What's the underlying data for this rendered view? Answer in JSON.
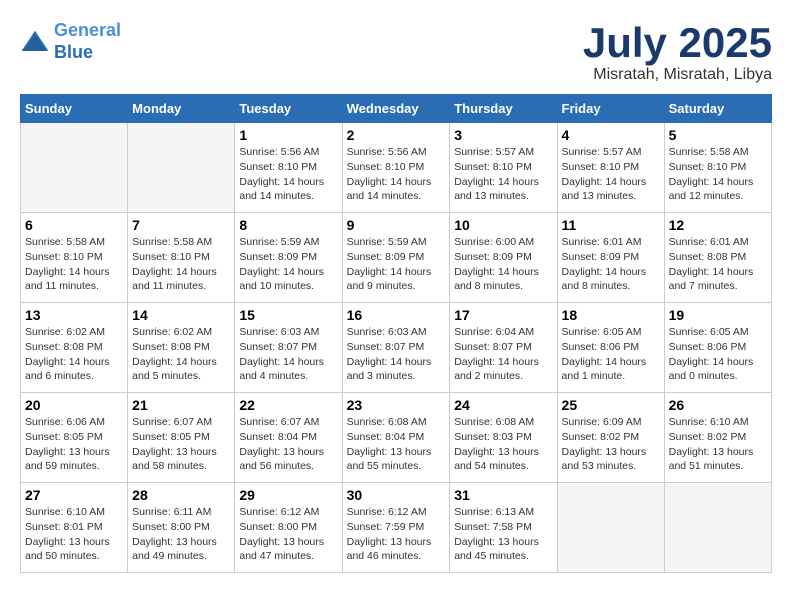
{
  "header": {
    "logo_line1": "General",
    "logo_line2": "Blue",
    "month_title": "July 2025",
    "location": "Misratah, Misratah, Libya"
  },
  "weekdays": [
    "Sunday",
    "Monday",
    "Tuesday",
    "Wednesday",
    "Thursday",
    "Friday",
    "Saturday"
  ],
  "weeks": [
    [
      {
        "day": "",
        "info": ""
      },
      {
        "day": "",
        "info": ""
      },
      {
        "day": "1",
        "info": "Sunrise: 5:56 AM\nSunset: 8:10 PM\nDaylight: 14 hours and 14 minutes."
      },
      {
        "day": "2",
        "info": "Sunrise: 5:56 AM\nSunset: 8:10 PM\nDaylight: 14 hours and 14 minutes."
      },
      {
        "day": "3",
        "info": "Sunrise: 5:57 AM\nSunset: 8:10 PM\nDaylight: 14 hours and 13 minutes."
      },
      {
        "day": "4",
        "info": "Sunrise: 5:57 AM\nSunset: 8:10 PM\nDaylight: 14 hours and 13 minutes."
      },
      {
        "day": "5",
        "info": "Sunrise: 5:58 AM\nSunset: 8:10 PM\nDaylight: 14 hours and 12 minutes."
      }
    ],
    [
      {
        "day": "6",
        "info": "Sunrise: 5:58 AM\nSunset: 8:10 PM\nDaylight: 14 hours and 11 minutes."
      },
      {
        "day": "7",
        "info": "Sunrise: 5:58 AM\nSunset: 8:10 PM\nDaylight: 14 hours and 11 minutes."
      },
      {
        "day": "8",
        "info": "Sunrise: 5:59 AM\nSunset: 8:09 PM\nDaylight: 14 hours and 10 minutes."
      },
      {
        "day": "9",
        "info": "Sunrise: 5:59 AM\nSunset: 8:09 PM\nDaylight: 14 hours and 9 minutes."
      },
      {
        "day": "10",
        "info": "Sunrise: 6:00 AM\nSunset: 8:09 PM\nDaylight: 14 hours and 8 minutes."
      },
      {
        "day": "11",
        "info": "Sunrise: 6:01 AM\nSunset: 8:09 PM\nDaylight: 14 hours and 8 minutes."
      },
      {
        "day": "12",
        "info": "Sunrise: 6:01 AM\nSunset: 8:08 PM\nDaylight: 14 hours and 7 minutes."
      }
    ],
    [
      {
        "day": "13",
        "info": "Sunrise: 6:02 AM\nSunset: 8:08 PM\nDaylight: 14 hours and 6 minutes."
      },
      {
        "day": "14",
        "info": "Sunrise: 6:02 AM\nSunset: 8:08 PM\nDaylight: 14 hours and 5 minutes."
      },
      {
        "day": "15",
        "info": "Sunrise: 6:03 AM\nSunset: 8:07 PM\nDaylight: 14 hours and 4 minutes."
      },
      {
        "day": "16",
        "info": "Sunrise: 6:03 AM\nSunset: 8:07 PM\nDaylight: 14 hours and 3 minutes."
      },
      {
        "day": "17",
        "info": "Sunrise: 6:04 AM\nSunset: 8:07 PM\nDaylight: 14 hours and 2 minutes."
      },
      {
        "day": "18",
        "info": "Sunrise: 6:05 AM\nSunset: 8:06 PM\nDaylight: 14 hours and 1 minute."
      },
      {
        "day": "19",
        "info": "Sunrise: 6:05 AM\nSunset: 8:06 PM\nDaylight: 14 hours and 0 minutes."
      }
    ],
    [
      {
        "day": "20",
        "info": "Sunrise: 6:06 AM\nSunset: 8:05 PM\nDaylight: 13 hours and 59 minutes."
      },
      {
        "day": "21",
        "info": "Sunrise: 6:07 AM\nSunset: 8:05 PM\nDaylight: 13 hours and 58 minutes."
      },
      {
        "day": "22",
        "info": "Sunrise: 6:07 AM\nSunset: 8:04 PM\nDaylight: 13 hours and 56 minutes."
      },
      {
        "day": "23",
        "info": "Sunrise: 6:08 AM\nSunset: 8:04 PM\nDaylight: 13 hours and 55 minutes."
      },
      {
        "day": "24",
        "info": "Sunrise: 6:08 AM\nSunset: 8:03 PM\nDaylight: 13 hours and 54 minutes."
      },
      {
        "day": "25",
        "info": "Sunrise: 6:09 AM\nSunset: 8:02 PM\nDaylight: 13 hours and 53 minutes."
      },
      {
        "day": "26",
        "info": "Sunrise: 6:10 AM\nSunset: 8:02 PM\nDaylight: 13 hours and 51 minutes."
      }
    ],
    [
      {
        "day": "27",
        "info": "Sunrise: 6:10 AM\nSunset: 8:01 PM\nDaylight: 13 hours and 50 minutes."
      },
      {
        "day": "28",
        "info": "Sunrise: 6:11 AM\nSunset: 8:00 PM\nDaylight: 13 hours and 49 minutes."
      },
      {
        "day": "29",
        "info": "Sunrise: 6:12 AM\nSunset: 8:00 PM\nDaylight: 13 hours and 47 minutes."
      },
      {
        "day": "30",
        "info": "Sunrise: 6:12 AM\nSunset: 7:59 PM\nDaylight: 13 hours and 46 minutes."
      },
      {
        "day": "31",
        "info": "Sunrise: 6:13 AM\nSunset: 7:58 PM\nDaylight: 13 hours and 45 minutes."
      },
      {
        "day": "",
        "info": ""
      },
      {
        "day": "",
        "info": ""
      }
    ]
  ]
}
